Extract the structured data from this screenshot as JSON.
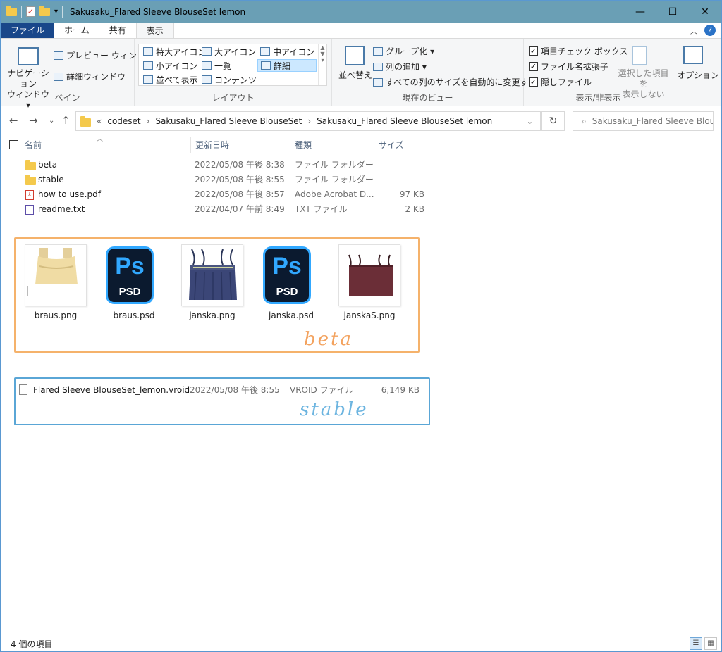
{
  "window": {
    "title": "Sakusaku_Flared Sleeve BlouseSet lemon",
    "minimize": "—",
    "maximize": "☐",
    "close": "✕"
  },
  "tabs": [
    "ファイル",
    "ホーム",
    "共有",
    "表示"
  ],
  "ribbon": {
    "pane": {
      "nav_pane": "ナビゲーション\nウィンドウ ▾",
      "preview": "プレビュー ウィンドウ",
      "details": "詳細ウィンドウ",
      "label": "ペイン"
    },
    "layout": {
      "items": [
        "特大アイコン",
        "大アイコン",
        "中アイコン",
        "小アイコン",
        "一覧",
        "詳細",
        "並べて表示",
        "コンテンツ"
      ],
      "selected": "詳細",
      "label": "レイアウト"
    },
    "current_view": {
      "sort": "並べ替え",
      "group": "グループ化 ▾",
      "add_column": "列の追加 ▾",
      "autosize": "すべての列のサイズを自動的に変更する",
      "label": "現在のビュー"
    },
    "show_hide": {
      "checkboxes": [
        "項目チェック ボックス",
        "ファイル名拡張子",
        "隠しファイル"
      ],
      "hide_selected": "選択した項目を\n表示しない",
      "label": "表示/非表示"
    },
    "options": "オプション"
  },
  "address": {
    "prefix": "«",
    "crumbs": [
      "codeset",
      "Sakusaku_Flared Sleeve BlouseSet",
      "Sakusaku_Flared Sleeve BlouseSet lemon"
    ],
    "search_placeholder": "Sakusaku_Flared Sleeve Blou..."
  },
  "columns": [
    "名前",
    "更新日時",
    "種類",
    "サイズ"
  ],
  "files": [
    {
      "name": "beta",
      "date": "2022/05/08 午後 8:38",
      "type": "ファイル フォルダー",
      "size": "",
      "icon": "folder-icon"
    },
    {
      "name": "stable",
      "date": "2022/05/08 午後 8:55",
      "type": "ファイル フォルダー",
      "size": "",
      "icon": "folder-icon"
    },
    {
      "name": "how to use.pdf",
      "date": "2022/05/08 午後 8:57",
      "type": "Adobe Acrobat D...",
      "size": "97 KB",
      "icon": "pdf-icon"
    },
    {
      "name": "readme.txt",
      "date": "2022/04/07 午前 8:49",
      "type": "TXT ファイル",
      "size": "2 KB",
      "icon": "txt-icon"
    }
  ],
  "beta_folder": {
    "annotation": "beta",
    "items": [
      {
        "name": "braus.png",
        "icon": "blouse-thumbnail"
      },
      {
        "name": "braus.psd",
        "icon": "photoshop-icon"
      },
      {
        "name": "janska.png",
        "icon": "jumper-skirt-navy-thumbnail"
      },
      {
        "name": "janska.psd",
        "icon": "photoshop-icon"
      },
      {
        "name": "janskaS.png",
        "icon": "jumper-skirt-maroon-thumbnail"
      }
    ],
    "ps_top": "Ps",
    "ps_bottom": "PSD"
  },
  "stable_folder": {
    "annotation": "stable",
    "file": {
      "name": "Flared Sleeve BlouseSet_lemon.vroid",
      "date": "2022/05/08 午後 8:55",
      "type": "VROID ファイル",
      "size": "6,149 KB"
    }
  },
  "status": {
    "count": "4 個の項目"
  },
  "colors": {
    "titlebar": "#6a9fb5",
    "file_tab": "#19478a",
    "beta_box": "#f5b26b",
    "stable_box": "#5aa6d6",
    "ps_blue": "#31a8ff"
  }
}
